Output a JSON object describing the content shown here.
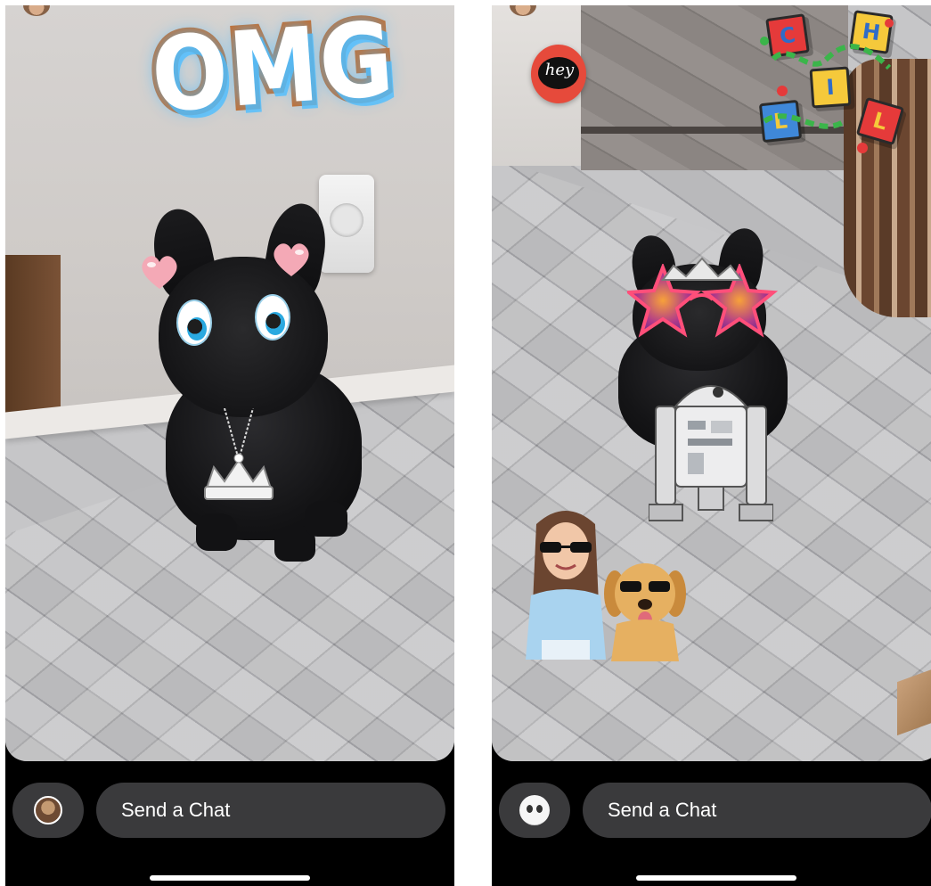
{
  "screens": [
    {
      "id": "left",
      "stickers": {
        "headline": "OMG"
      },
      "chat_bar": {
        "placeholder": "Send a Chat",
        "avatar_icon": "bitmoji-avatar-icon"
      }
    },
    {
      "id": "right",
      "stickers": {
        "speech": "hey",
        "blocks": [
          "C",
          "H",
          "I",
          "L",
          "L"
        ]
      },
      "chat_bar": {
        "placeholder": "Send a Chat",
        "avatar_icon": "ghost-avatar-icon"
      }
    }
  ],
  "colors": {
    "bar_background": "#000000",
    "input_background": "#3a3a3c",
    "text": "#ffffff",
    "omg_outline": "#c86b2a",
    "omg_glow": "#50beff"
  }
}
